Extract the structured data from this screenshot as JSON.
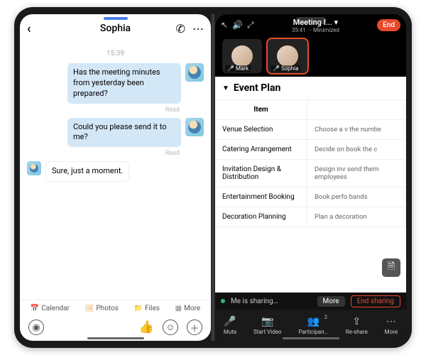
{
  "chat": {
    "contact": "Sophia",
    "timestamp": "15:39",
    "read_label": "Read",
    "messages": {
      "m1": "Has the meeting minutes from yesterday been prepared?",
      "m2": "Could you please send it to me?",
      "m3": "Sure, just a moment."
    },
    "quick": {
      "calendar": "Calendar",
      "photos": "Photos",
      "files": "Files",
      "more": "More"
    }
  },
  "meeting": {
    "title": "Meeting I...",
    "subtitle": "35:41 ··· Minimized",
    "end_label": "End",
    "participants": [
      {
        "name": "Mark"
      },
      {
        "name": "Sophia"
      }
    ],
    "doc_title": "Event Plan",
    "table": {
      "header_item": "Item",
      "header_desc": "",
      "rows": [
        {
          "item": "Venue Selection",
          "desc": "Choose a v the numbe"
        },
        {
          "item": "Catering Arrangement",
          "desc": "Decide on book the c"
        },
        {
          "item": "Invitation Design & Distribution",
          "desc": "Design inv send them employees"
        },
        {
          "item": "Entertainment Booking",
          "desc": "Book perfo bands"
        },
        {
          "item": "Decoration Planning",
          "desc": "Plan a decoration"
        }
      ]
    },
    "share": {
      "status": "Me is sharing…",
      "more": "More",
      "end": "End sharing"
    },
    "bottom": {
      "mute": "Mute",
      "video": "Start Video",
      "participants": "Participan...",
      "reshare": "Re-share",
      "more": "More",
      "count": "2"
    }
  }
}
